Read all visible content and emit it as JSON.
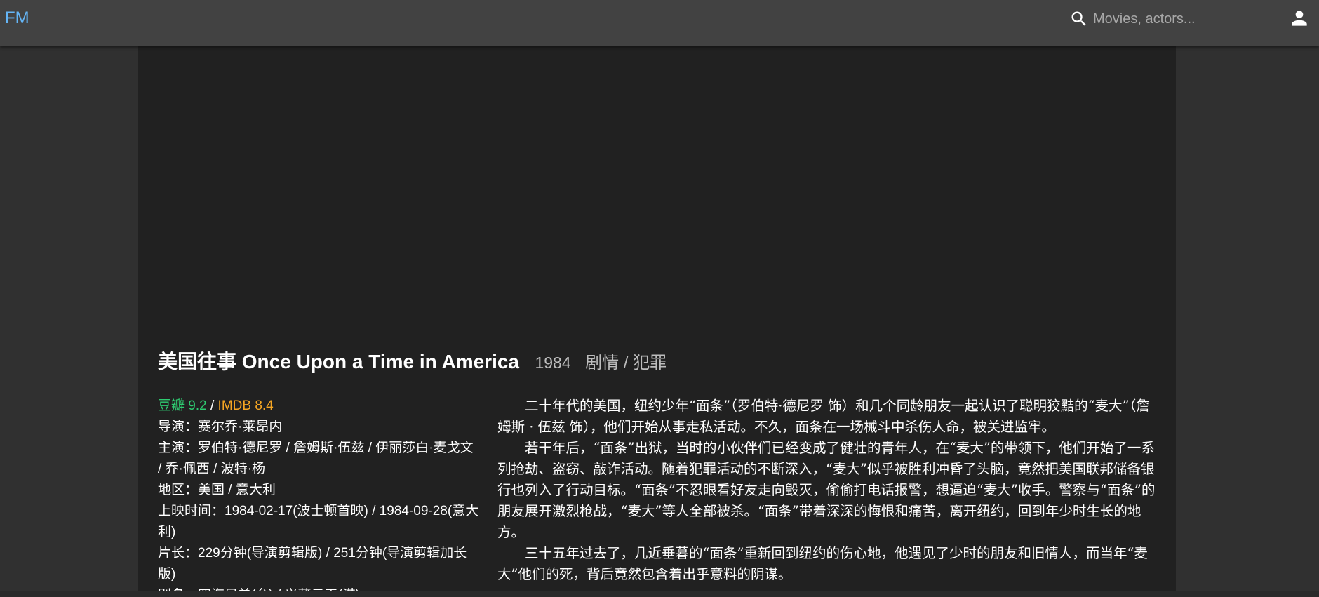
{
  "app": {
    "brand": "FM"
  },
  "search": {
    "placeholder": "Movies, actors...",
    "value": ""
  },
  "movie": {
    "title": "美国往事 Once Upon a Time in America",
    "year": "1984",
    "genres": "剧情 / 犯罪",
    "ratings": {
      "douban": "豆瓣 9.2",
      "separator": " / ",
      "imdb": "IMDB 8.4"
    },
    "info": [
      "导演：赛尔乔·莱昂内",
      "主演：罗伯特·德尼罗 / 詹姆斯·伍兹 / 伊丽莎白·麦戈文 / 乔·佩西 / 波特·杨",
      "地区：美国 / 意大利",
      "上映时间：1984-02-17(波士顿首映) / 1984-09-28(意大利)",
      "片长：229分钟(导演剪辑版) / 251分钟(导演剪辑加长版)",
      "别名：四海兄弟(台) / 义薄云天(港)"
    ],
    "synopsis": [
      "二十年代的美国，纽约少年“面条”（罗伯特·德尼罗 饰）和几个同龄朋友一起认识了聪明狡黠的“麦大”（詹姆斯 · 伍兹 饰），他们开始从事走私活动。不久，面条在一场械斗中杀伤人命，被关进监牢。",
      "若干年后，“面条”出狱，当时的小伙伴们已经变成了健壮的青年人，在“麦大”的带领下，他们开始了一系列抢劫、盗窃、敲诈活动。随着犯罪活动的不断深入，“麦大”似乎被胜利冲昏了头脑，竟然把美国联邦储备银行也列入了行动目标。“面条”不忍眼看好友走向毁灭，偷偷打电话报警，想逼迫“麦大”收手。警察与“面条”的朋友展开激烈枪战，“麦大”等人全部被杀。“面条”带着深深的悔恨和痛苦，离开纽约，回到年少时生长的地方。",
      "三十五年过去了，几近垂暮的“面条”重新回到纽约的伤心地，他遇见了少时的朋友和旧情人，而当年“麦大”他们的死，背后竟然包含着出乎意料的阴谋。"
    ]
  },
  "colors": {
    "brand": "#64b5f6",
    "douban": "#2ecc71",
    "imdb": "#f5a623",
    "appbar": "#424242",
    "content_bg": "#212121",
    "page_bg": "#303030"
  },
  "icons": {
    "search": "search-icon",
    "account": "account-icon"
  }
}
